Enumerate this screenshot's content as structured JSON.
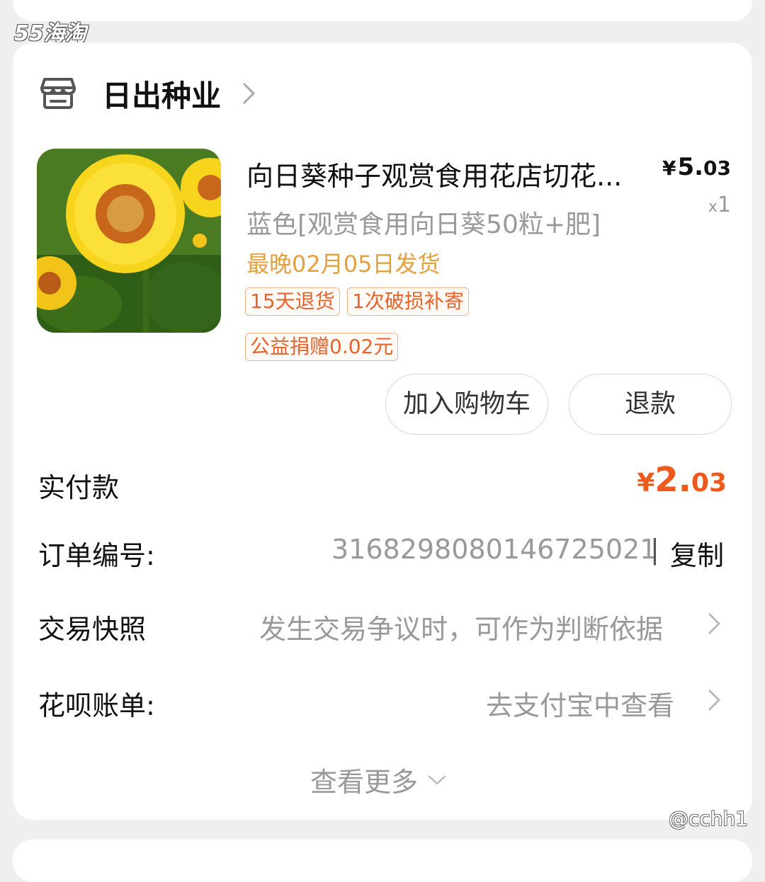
{
  "watermark": {
    "top_left": "55海淘",
    "bottom_right": "@cchh1"
  },
  "shop": {
    "name": "日出种业",
    "icon": "store-icon"
  },
  "product": {
    "title": "向日葵种子观赏食用花店切花...",
    "price_symbol": "¥",
    "price_int": "5.",
    "price_dec": "03",
    "qty_x": "x",
    "qty_num": "1",
    "sku": "蓝色[观赏食用向日葵50粒+肥]",
    "shipping": "最晚02月05日发货",
    "tags": [
      "15天退货",
      "1次破损补寄",
      "公益捐赠0.02元"
    ]
  },
  "buttons": {
    "add_to_cart": "加入购物车",
    "refund": "退款"
  },
  "order": {
    "paid_label": "实付款",
    "paid_symbol": "¥",
    "paid_int": "2.",
    "paid_dec": "03",
    "order_no_label": "订单编号:",
    "order_no": "3168298080146725021",
    "separator": "|",
    "copy": "复制",
    "snapshot_label": "交易快照",
    "snapshot_hint": "发生交易争议时，可作为判断依据",
    "huabei_label": "花呗账单:",
    "huabei_hint": "去支付宝中查看",
    "view_more": "查看更多"
  },
  "colors": {
    "accent": "#ee5a1c",
    "shipping": "#e3a03d",
    "tag_border": "#f3b48a"
  }
}
